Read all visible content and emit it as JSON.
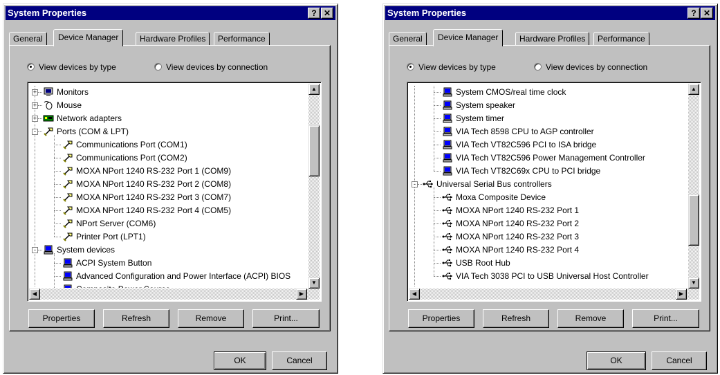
{
  "colors": {
    "titlebar": "#000080",
    "face": "#c0c0c0",
    "list_bg": "#ffffff"
  },
  "windows": [
    {
      "title": "System Properties",
      "help_label": "?",
      "close_label": "✕",
      "tabs": [
        "General",
        "Device Manager",
        "Hardware Profiles",
        "Performance"
      ],
      "active_tab": "Device Manager",
      "radio_type": "View devices by type",
      "radio_connection": "View devices by connection",
      "selected_view": "type",
      "devices": [
        {
          "label": "Monitors",
          "level": 0,
          "expander": "+",
          "icon": "monitor-icon"
        },
        {
          "label": "Mouse",
          "level": 0,
          "expander": "+",
          "icon": "mouse-icon"
        },
        {
          "label": "Network adapters",
          "level": 0,
          "expander": "+",
          "icon": "network-adapter-icon"
        },
        {
          "label": "Ports (COM & LPT)",
          "level": 0,
          "expander": "-",
          "icon": "port-icon"
        },
        {
          "label": "Communications Port (COM1)",
          "level": 1,
          "icon": "port-icon"
        },
        {
          "label": "Communications Port (COM2)",
          "level": 1,
          "icon": "port-icon"
        },
        {
          "label": "MOXA NPort 1240 RS-232 Port 1 (COM9)",
          "level": 1,
          "icon": "port-icon"
        },
        {
          "label": "MOXA NPort 1240 RS-232 Port 2 (COM8)",
          "level": 1,
          "icon": "port-icon"
        },
        {
          "label": "MOXA NPort 1240 RS-232 Port 3 (COM7)",
          "level": 1,
          "icon": "port-icon"
        },
        {
          "label": "MOXA NPort 1240 RS-232 Port 4 (COM5)",
          "level": 1,
          "icon": "port-icon"
        },
        {
          "label": "NPort Server (COM6)",
          "level": 1,
          "icon": "port-icon"
        },
        {
          "label": "Printer Port (LPT1)",
          "level": 1,
          "icon": "port-icon"
        },
        {
          "label": "System devices",
          "level": 0,
          "expander": "-",
          "icon": "system-device-icon"
        },
        {
          "label": "ACPI System Button",
          "level": 1,
          "icon": "system-device-icon"
        },
        {
          "label": "Advanced Configuration and Power Interface (ACPI) BIOS",
          "level": 1,
          "icon": "system-device-icon"
        },
        {
          "label": "Composite Power Source",
          "level": 1,
          "icon": "system-device-icon"
        }
      ],
      "scroll_fraction": 0.25,
      "buttons": {
        "properties": "Properties",
        "refresh": "Refresh",
        "remove": "Remove",
        "print": "Print..."
      },
      "ok_label": "OK",
      "cancel_label": "Cancel"
    },
    {
      "title": "System Properties",
      "help_label": "?",
      "close_label": "✕",
      "tabs": [
        "General",
        "Device Manager",
        "Hardware Profiles",
        "Performance"
      ],
      "active_tab": "Device Manager",
      "radio_type": "View devices by type",
      "radio_connection": "View devices by connection",
      "selected_view": "type",
      "devices": [
        {
          "label": "System CMOS/real time clock",
          "level": 1,
          "icon": "system-device-icon"
        },
        {
          "label": "System speaker",
          "level": 1,
          "icon": "system-device-icon"
        },
        {
          "label": "System timer",
          "level": 1,
          "icon": "system-device-icon"
        },
        {
          "label": "VIA Tech 8598 CPU to AGP controller",
          "level": 1,
          "icon": "system-device-icon"
        },
        {
          "label": "VIA Tech VT82C596 PCI to ISA bridge",
          "level": 1,
          "icon": "system-device-icon"
        },
        {
          "label": "VIA Tech VT82C596 Power Management Controller",
          "level": 1,
          "icon": "system-device-icon"
        },
        {
          "label": "VIA Tech VT82C69x CPU to PCI bridge",
          "level": 1,
          "icon": "system-device-icon"
        },
        {
          "label": "Universal Serial Bus controllers",
          "level": 0,
          "expander": "-",
          "icon": "usb-icon"
        },
        {
          "label": "Moxa Composite Device",
          "level": 1,
          "icon": "usb-icon"
        },
        {
          "label": "MOXA NPort 1240 RS-232 Port 1",
          "level": 1,
          "icon": "usb-icon"
        },
        {
          "label": "MOXA NPort 1240 RS-232 Port 2",
          "level": 1,
          "icon": "usb-icon"
        },
        {
          "label": "MOXA NPort 1240 RS-232 Port 3",
          "level": 1,
          "icon": "usb-icon"
        },
        {
          "label": "MOXA NPort 1240 RS-232 Port 4",
          "level": 1,
          "icon": "usb-icon"
        },
        {
          "label": "USB Root Hub",
          "level": 1,
          "icon": "usb-icon"
        },
        {
          "label": "VIA Tech 3038 PCI to USB Universal Host Controller",
          "level": 1,
          "icon": "usb-icon"
        }
      ],
      "scroll_fraction": 0.82,
      "buttons": {
        "properties": "Properties",
        "refresh": "Refresh",
        "remove": "Remove",
        "print": "Print..."
      },
      "ok_label": "OK",
      "cancel_label": "Cancel"
    }
  ]
}
